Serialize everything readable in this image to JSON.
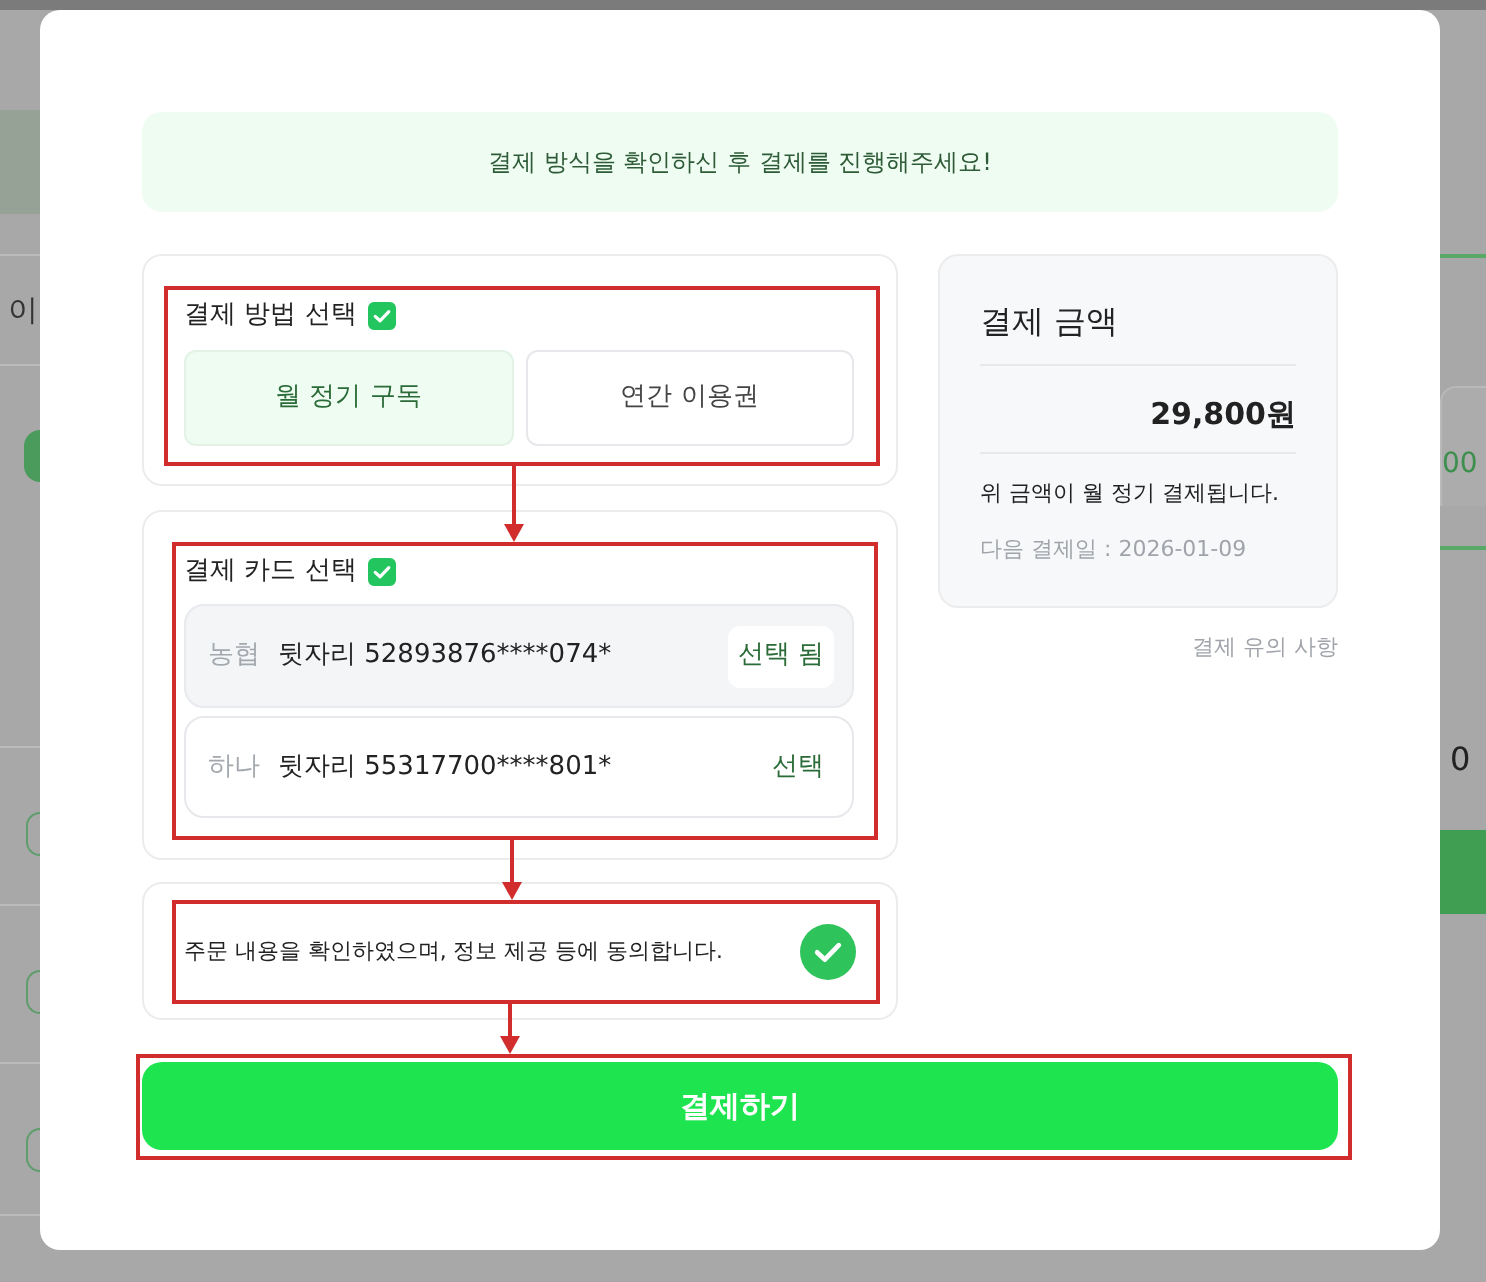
{
  "backdrop": {
    "left_fragment": "이",
    "right_fragments": [
      "00",
      "0"
    ]
  },
  "banner": {
    "text": "결제 방식을 확인하신 후 결제를 진행해주세요!"
  },
  "payment_method": {
    "title": "결제 방법 선택",
    "checked": true,
    "options": [
      {
        "label": "월 정기 구독",
        "selected": true
      },
      {
        "label": "연간 이용권",
        "selected": false
      }
    ]
  },
  "payment_card": {
    "title": "결제 카드 선택",
    "checked": true,
    "cards": [
      {
        "bank": "농협",
        "number": "뒷자리 52893876****074*",
        "action": "선택 됨",
        "selected": true
      },
      {
        "bank": "하나",
        "number": "뒷자리 55317700****801*",
        "action": "선택",
        "selected": false
      }
    ]
  },
  "agreement": {
    "text": "주문 내용을 확인하였으며, 정보 제공 등에 동의합니다.",
    "checked": true
  },
  "summary": {
    "title": "결제 금액",
    "amount": "29,800원",
    "note": "위 금액이 월 정기 결제됩니다.",
    "next_date": "다음 결제일 : 2026-01-09"
  },
  "notice_link": "결제 유의 사항",
  "pay_button": {
    "label": "결제하기"
  }
}
